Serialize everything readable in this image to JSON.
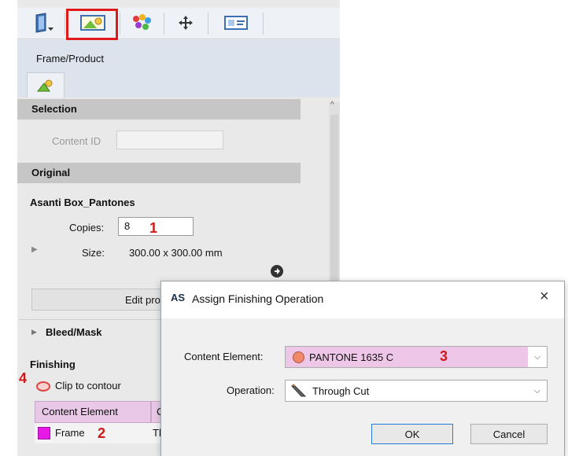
{
  "toolbar": {
    "icons": [
      "document-icon",
      "frame-product-icon",
      "color-palette-icon",
      "move-icon",
      "card-icon"
    ]
  },
  "tab": {
    "label": "Frame/Product"
  },
  "selection": {
    "header": "Selection",
    "content_id_label": "Content ID",
    "content_id_value": ""
  },
  "original": {
    "header": "Original",
    "name": "Asanti Box_Pantones",
    "copies_label": "Copies:",
    "copies_value": "8",
    "size_label": "Size:",
    "size_value": "300.00 x 300.00 mm",
    "edit_button": "Edit pro"
  },
  "bleed": {
    "header": "Bleed/Mask"
  },
  "finishing": {
    "header": "Finishing",
    "clip_label": "Clip to contour",
    "table_headers": [
      "Content Element",
      "C"
    ],
    "rows": [
      {
        "name": "Frame",
        "cell": "Th",
        "color": "#e619e6"
      }
    ]
  },
  "markers": {
    "m1": "1",
    "m2": "2",
    "m3": "3",
    "m4": "4"
  },
  "dialog": {
    "title": "Assign Finishing Operation",
    "app_icon_text": "AS",
    "close": "×",
    "content_element_label": "Content Element:",
    "content_element_value": "PANTONE 1635 C",
    "content_element_color": "#f08a6a",
    "operation_label": "Operation:",
    "operation_value": "Through Cut",
    "ok": "OK",
    "cancel": "Cancel"
  },
  "colors": {
    "highlight_red": "#e01a1a",
    "selected_bg": "#eec6e8",
    "marker_red": "#d01818"
  }
}
